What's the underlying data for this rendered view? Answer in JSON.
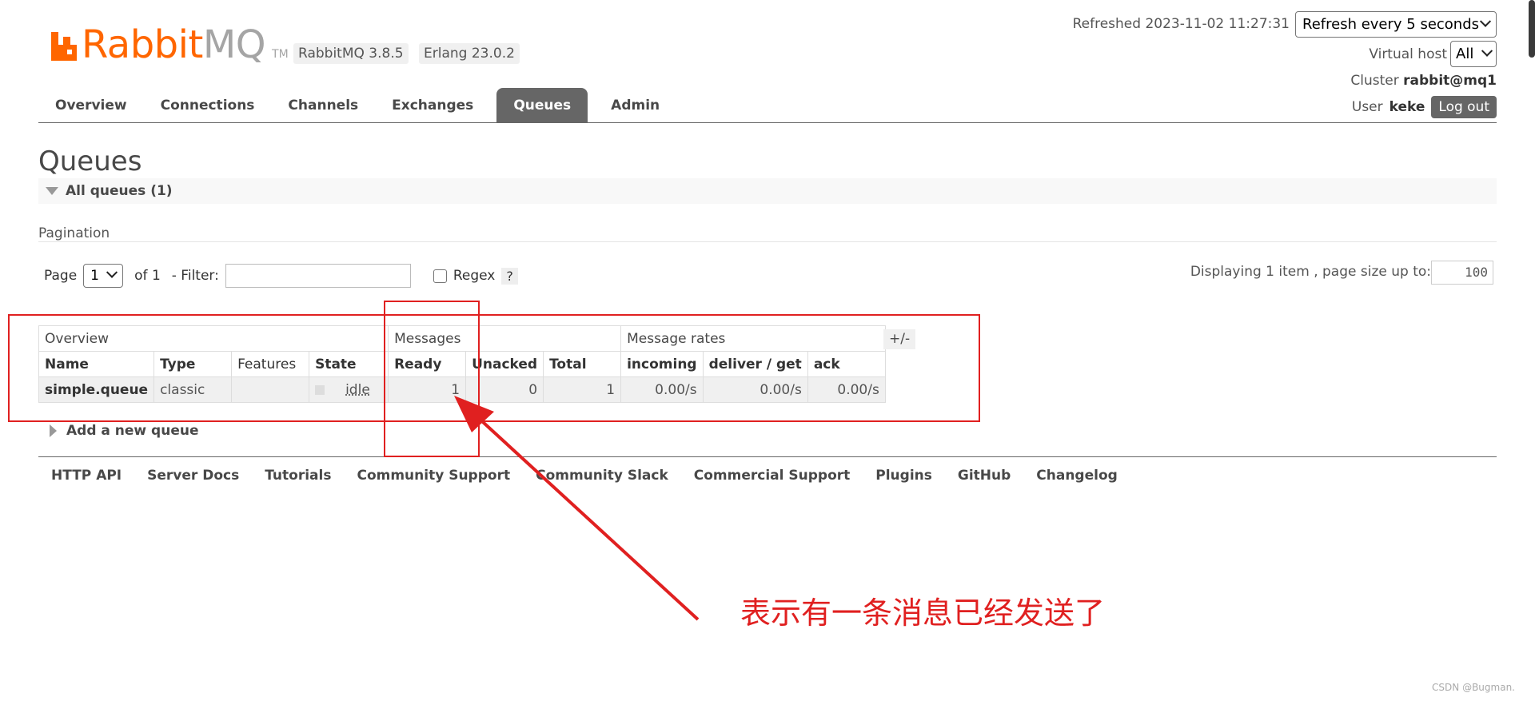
{
  "app": {
    "brand_main": "Rabbit",
    "brand_sub": "MQ",
    "brand_tm": "TM",
    "version": "RabbitMQ 3.8.5",
    "erlang": "Erlang 23.0.2"
  },
  "header": {
    "refreshed": "Refreshed 2023-11-02 11:27:31",
    "refresh_select": "Refresh every 5 seconds",
    "vhost_label": "Virtual host",
    "vhost_select": "All",
    "cluster_label": "Cluster",
    "cluster_name": "rabbit@mq1",
    "user_label": "User",
    "user_name": "keke",
    "logout": "Log out"
  },
  "tabs": [
    "Overview",
    "Connections",
    "Channels",
    "Exchanges",
    "Queues",
    "Admin"
  ],
  "page": {
    "title": "Queues",
    "all_queues": "All queues (1)",
    "pagination_label": "Pagination",
    "page_label": "Page",
    "page_value": "1",
    "of_label": "of 1",
    "filter_label": "- Filter:",
    "regex_label": "Regex",
    "help": "?",
    "displaying": "Displaying 1 item , page size up to:",
    "page_size": "100"
  },
  "table": {
    "groups": [
      "Overview",
      "Messages",
      "Message rates"
    ],
    "columns": [
      "Name",
      "Type",
      "Features",
      "State",
      "Ready",
      "Unacked",
      "Total",
      "incoming",
      "deliver / get",
      "ack"
    ],
    "row": {
      "name": "simple.queue",
      "type": "classic",
      "features": "",
      "state": "idle",
      "ready": "1",
      "unacked": "0",
      "total": "1",
      "incoming": "0.00/s",
      "deliver_get": "0.00/s",
      "ack": "0.00/s"
    },
    "toggle": "+/-"
  },
  "add_queue": "Add a new queue",
  "footer": [
    "HTTP API",
    "Server Docs",
    "Tutorials",
    "Community Support",
    "Community Slack",
    "Commercial Support",
    "Plugins",
    "GitHub",
    "Changelog"
  ],
  "annotation": {
    "text": "表示有一条消息已经发送了",
    "color": "#e02020"
  },
  "watermark": "CSDN @Bugman.",
  "colors": {
    "brand": "#ff6600",
    "tab_active": "#666666"
  }
}
